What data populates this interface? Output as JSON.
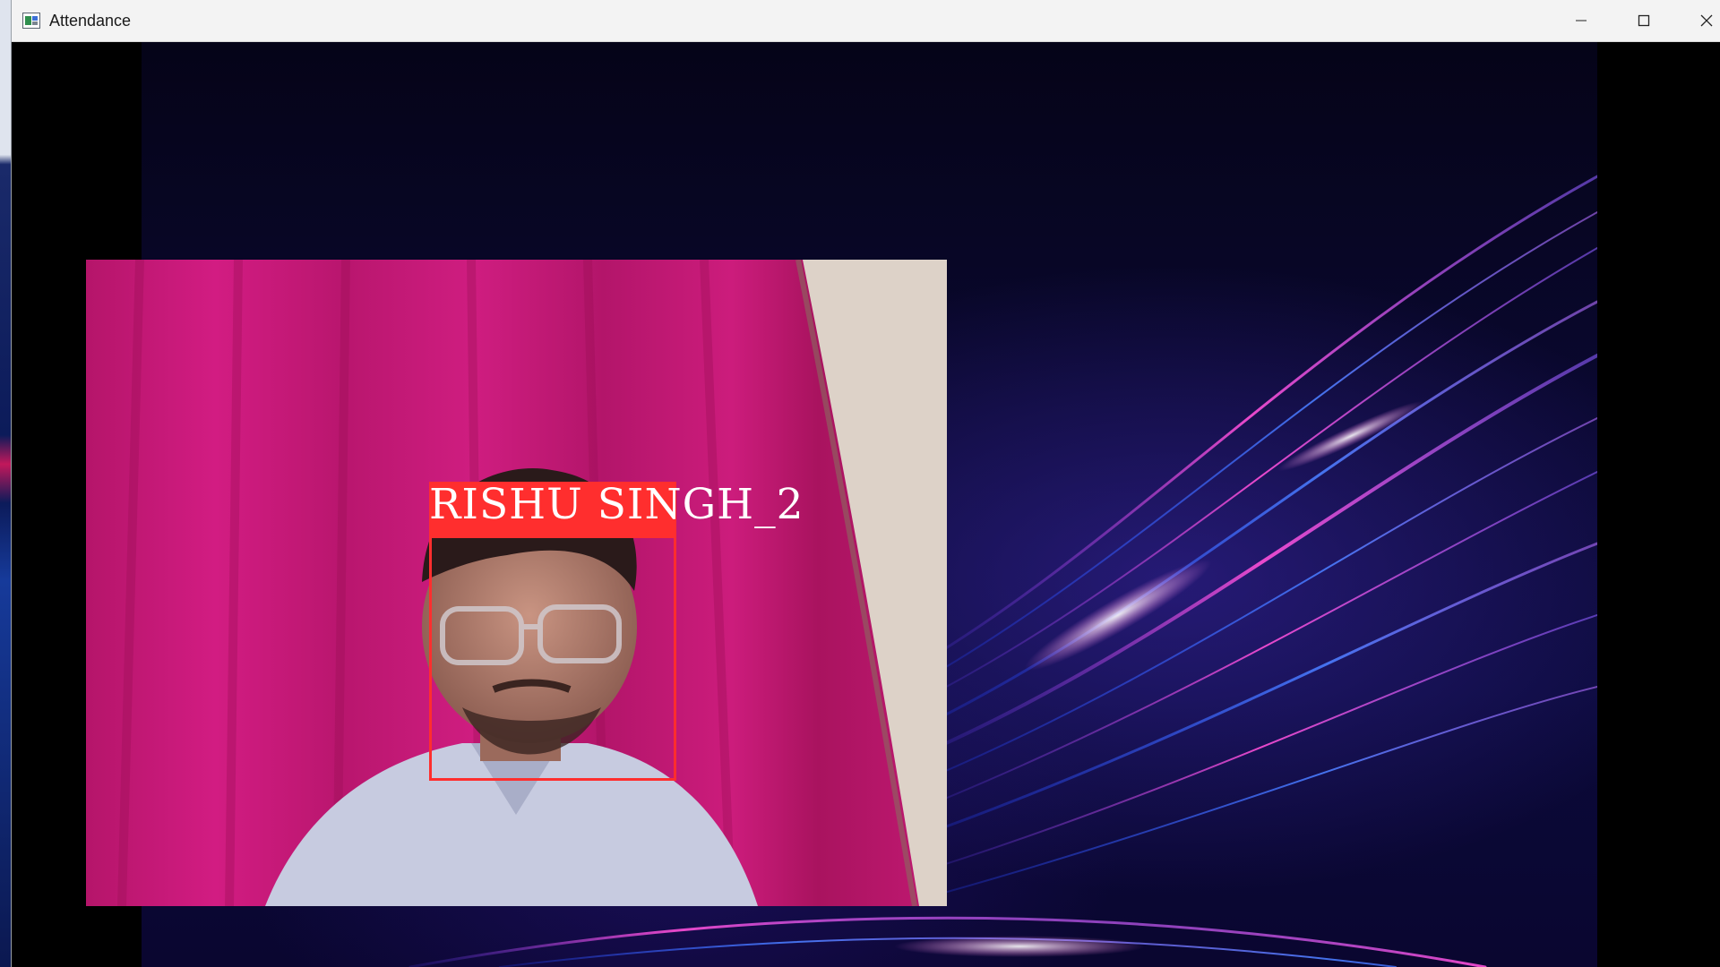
{
  "window": {
    "title": "Attendance",
    "icon": "app-window-icon",
    "controls": {
      "minimize_icon": "minimize-icon",
      "maximize_icon": "maximize-icon",
      "close_icon": "close-icon"
    }
  },
  "recognition": {
    "label": "RISHU SINGH_2",
    "box_color": "#ff2e2e",
    "label_text_color": "#ffffff"
  },
  "colors": {
    "titlebar": "#f3f3f3",
    "background_dark": "#0a0830",
    "curtain": "#c2186f",
    "light_streak_pink": "#ff4fd8",
    "light_streak_blue": "#4a7dff"
  }
}
